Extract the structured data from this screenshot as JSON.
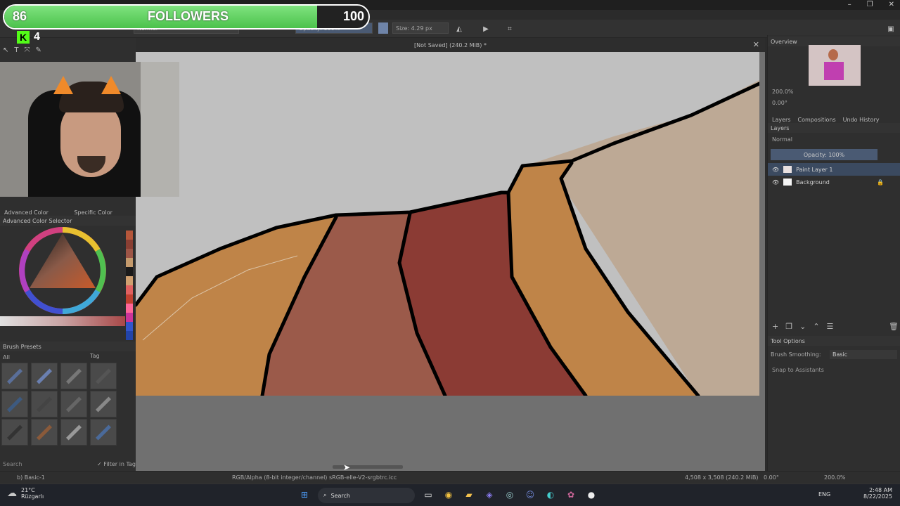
{
  "window": {
    "title": "[Not Saved]  (240.2 MiB) *"
  },
  "overlay": {
    "followers_current": "86",
    "followers_label": "FOLLOWERS",
    "followers_goal": "100",
    "followers_progress": 0.86,
    "kick_count": "4"
  },
  "toolbar": {
    "blend_mode": "Normal",
    "opacity": "Opacity: 100%",
    "size": "Size: 4.29 px"
  },
  "left": {
    "color_tabs": [
      "Advanced Color Select...",
      "Specific Color Select..."
    ],
    "color_selector_title": "Advanced Color Selector",
    "brush_presets_title": "Brush Presets",
    "brush_filter": "All",
    "brush_tag": "Tag",
    "search_placeholder": "Search",
    "filter_in_tag": "Filter in Tag",
    "palette": [
      "#b5563a",
      "#8a3f33",
      "#9d5546",
      "#c49a6c",
      "#1a1a1a",
      "#d0a070",
      "#e06060",
      "#c04030",
      "#ff6699",
      "#cc3399",
      "#3355cc",
      "#2244aa"
    ]
  },
  "right": {
    "overview_title": "Overview",
    "zoom": "200.0%",
    "rotation": "0.00°",
    "tabs": [
      "Layers",
      "Compositions",
      "Undo History"
    ],
    "layers_title": "Layers",
    "blend": "Normal",
    "opacity": "Opacity:  100%",
    "layers": [
      {
        "name": "Paint Layer 1",
        "active": true
      },
      {
        "name": "Background",
        "active": false
      }
    ],
    "tool_options_title": "Tool Options",
    "brush_smoothing_label": "Brush Smoothing:",
    "brush_smoothing_value": "Basic",
    "snap_label": "Snap to Assistants"
  },
  "status": {
    "brush": "b) Basic-1",
    "color_space": "RGB/Alpha (8-bit integer/channel)  sRGB-elle-V2-srgbtrc.icc",
    "dimensions": "4,508 x 3,508 (240.2 MiB)",
    "rotation": "0.00°",
    "zoom": "200.0%"
  },
  "taskbar": {
    "weather_temp": "21°C",
    "weather_place": "Rüzgarlı",
    "search_placeholder": "Search",
    "lang": "ENG",
    "time": "2:48 AM",
    "date": "8/22/2025"
  },
  "colors": {
    "sky": "#c0c0c0",
    "sand": "#bda995",
    "ochre": "#bf8448",
    "rust": "#9b5a4a",
    "brick": "#8b3b34",
    "outline": "#000000",
    "follow_green": "#5fd35f"
  }
}
